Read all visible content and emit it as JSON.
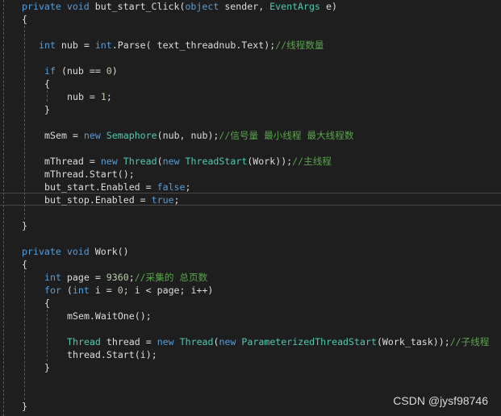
{
  "colors": {
    "background": "#1e1e1e",
    "keyword": "#569cd6",
    "type": "#4ec9b0",
    "comment": "#57a64a",
    "number": "#b5cea8",
    "text": "#dcdcdc"
  },
  "code": [
    {
      "indent": 0,
      "tokens": [
        [
          "private ",
          "kw"
        ],
        [
          "void ",
          "kw"
        ],
        [
          "but_start_Click(",
          "tx"
        ],
        [
          "object ",
          "kw"
        ],
        [
          "sender, ",
          "tx"
        ],
        [
          "EventArgs ",
          "ty"
        ],
        [
          "e)",
          "tx"
        ]
      ]
    },
    {
      "indent": 0,
      "tokens": [
        [
          "{",
          "tx"
        ]
      ]
    },
    {
      "indent": 0,
      "tokens": []
    },
    {
      "indent": 3,
      "tokens": [
        [
          "int ",
          "kw"
        ],
        [
          "nub = ",
          "tx"
        ],
        [
          "int",
          "kw"
        ],
        [
          ".Parse( text_threadnub.Text);",
          "tx"
        ],
        [
          "//线程数量",
          "cm"
        ]
      ]
    },
    {
      "indent": 0,
      "tokens": []
    },
    {
      "indent": 4,
      "tokens": [
        [
          "if ",
          "kw"
        ],
        [
          "(nub == ",
          "tx"
        ],
        [
          "0",
          "nu"
        ],
        [
          ")",
          "tx"
        ]
      ]
    },
    {
      "indent": 4,
      "tokens": [
        [
          "{",
          "tx"
        ]
      ]
    },
    {
      "indent": 8,
      "tokens": [
        [
          "nub = ",
          "tx"
        ],
        [
          "1",
          "nu"
        ],
        [
          ";",
          "tx"
        ]
      ]
    },
    {
      "indent": 4,
      "tokens": [
        [
          "}",
          "tx"
        ]
      ]
    },
    {
      "indent": 0,
      "tokens": []
    },
    {
      "indent": 4,
      "tokens": [
        [
          "mSem = ",
          "tx"
        ],
        [
          "new ",
          "kw"
        ],
        [
          "Semaphore",
          "ty"
        ],
        [
          "(nub, nub);",
          "tx"
        ],
        [
          "//信号量 最小线程 最大线程数",
          "cm"
        ]
      ]
    },
    {
      "indent": 0,
      "tokens": []
    },
    {
      "indent": 4,
      "tokens": [
        [
          "mThread = ",
          "tx"
        ],
        [
          "new ",
          "kw"
        ],
        [
          "Thread",
          "ty"
        ],
        [
          "(",
          "tx"
        ],
        [
          "new ",
          "kw"
        ],
        [
          "ThreadStart",
          "ty"
        ],
        [
          "(Work));",
          "tx"
        ],
        [
          "//主线程",
          "cm"
        ]
      ]
    },
    {
      "indent": 4,
      "tokens": [
        [
          "mThread.Start();",
          "tx"
        ]
      ]
    },
    {
      "indent": 4,
      "tokens": [
        [
          "but_start.Enabled = ",
          "tx"
        ],
        [
          "false",
          "kw"
        ],
        [
          ";",
          "tx"
        ]
      ]
    },
    {
      "indent": 4,
      "tokens": [
        [
          "but_stop.Enabled = ",
          "tx"
        ],
        [
          "true",
          "kw"
        ],
        [
          ";",
          "tx"
        ]
      ]
    },
    {
      "indent": 0,
      "tokens": []
    },
    {
      "indent": 0,
      "tokens": [
        [
          "}",
          "tx"
        ]
      ]
    },
    {
      "indent": 0,
      "tokens": []
    },
    {
      "indent": 0,
      "tokens": [
        [
          "private ",
          "kw"
        ],
        [
          "void ",
          "kw"
        ],
        [
          "Work()",
          "tx"
        ]
      ]
    },
    {
      "indent": 0,
      "tokens": [
        [
          "{",
          "tx"
        ]
      ]
    },
    {
      "indent": 4,
      "tokens": [
        [
          "int ",
          "kw"
        ],
        [
          "page = ",
          "tx"
        ],
        [
          "9360",
          "nu"
        ],
        [
          ";",
          "tx"
        ],
        [
          "//采集的 总页数",
          "cm"
        ]
      ]
    },
    {
      "indent": 4,
      "tokens": [
        [
          "for ",
          "kw"
        ],
        [
          "(",
          "tx"
        ],
        [
          "int ",
          "kw"
        ],
        [
          "i = ",
          "tx"
        ],
        [
          "0",
          "nu"
        ],
        [
          "; i < page; i++)",
          "tx"
        ]
      ]
    },
    {
      "indent": 4,
      "tokens": [
        [
          "{",
          "tx"
        ]
      ]
    },
    {
      "indent": 8,
      "tokens": [
        [
          "mSem.WaitOne();",
          "tx"
        ]
      ]
    },
    {
      "indent": 0,
      "tokens": []
    },
    {
      "indent": 8,
      "tokens": [
        [
          "Thread ",
          "ty"
        ],
        [
          "thread = ",
          "tx"
        ],
        [
          "new ",
          "kw"
        ],
        [
          "Thread",
          "ty"
        ],
        [
          "(",
          "tx"
        ],
        [
          "new ",
          "kw"
        ],
        [
          "ParameterizedThreadStart",
          "ty"
        ],
        [
          "(Work_task));",
          "tx"
        ],
        [
          "//子线程",
          "cm"
        ]
      ]
    },
    {
      "indent": 8,
      "tokens": [
        [
          "thread.Start(i);",
          "tx"
        ]
      ]
    },
    {
      "indent": 4,
      "tokens": [
        [
          "}",
          "tx"
        ]
      ]
    },
    {
      "indent": 0,
      "tokens": []
    },
    {
      "indent": 0,
      "tokens": []
    },
    {
      "indent": 0,
      "tokens": [
        [
          "}",
          "tx"
        ]
      ]
    }
  ],
  "watermark": "CSDN @jysf98746"
}
